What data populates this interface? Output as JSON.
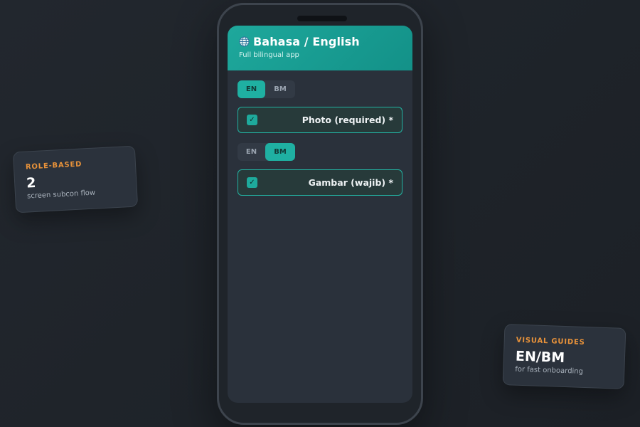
{
  "app": {
    "title": "Bahasa / English",
    "subtitle": "Full bilingual app",
    "globe_icon": "globe-icon"
  },
  "groups": [
    {
      "toggle": {
        "options": [
          "EN",
          "BM"
        ],
        "selected": "EN"
      },
      "field": {
        "label": "Photo (required) *",
        "checked": true
      }
    },
    {
      "toggle": {
        "options": [
          "EN",
          "BM"
        ],
        "selected": "BM"
      },
      "field": {
        "label": "Gambar (wajib) *",
        "checked": true
      }
    }
  ],
  "cards": {
    "left": {
      "label": "ROLE-BASED",
      "value": "2",
      "desc": "screen subcon flow"
    },
    "right": {
      "label": "VISUAL GUIDES",
      "value": "EN/BM",
      "desc": "for fast onboarding"
    }
  },
  "colors": {
    "accent": "#1fb0a2",
    "header": "#1ea89c",
    "card_label": "#e8923a",
    "background": "#22272e"
  }
}
